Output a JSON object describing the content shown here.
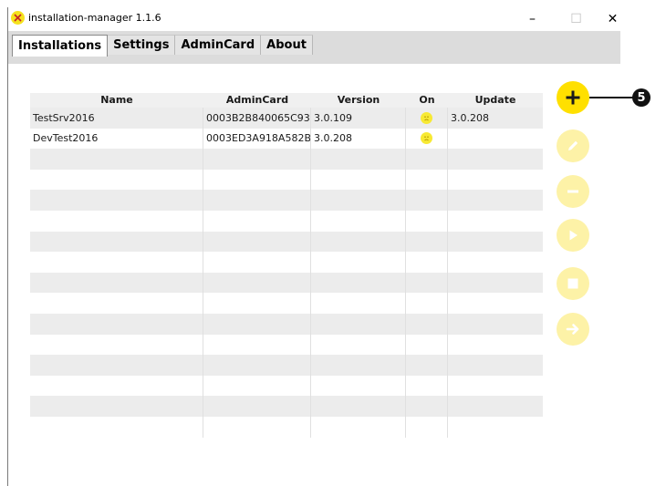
{
  "window": {
    "title": "installation-manager 1.1.6",
    "app_icon": "close-x-badge-icon",
    "minimize_glyph": "–",
    "maximize_glyph": "☐",
    "close_glyph": "✕"
  },
  "tabs": [
    {
      "label": "Installations",
      "active": true
    },
    {
      "label": "Settings",
      "active": false
    },
    {
      "label": "AdminCard",
      "active": false
    },
    {
      "label": "About",
      "active": false
    }
  ],
  "table": {
    "columns": [
      "Name",
      "AdminCard",
      "Version",
      "On",
      "Update"
    ],
    "rows": [
      {
        "name": "TestSrv2016",
        "admincard": "0003B2B840065C93",
        "version": "3.0.109",
        "on_icon": "sad-face-icon",
        "update": "3.0.208"
      },
      {
        "name": "DevTest2016",
        "admincard": "0003ED3A918A582B",
        "version": "3.0.208",
        "on_icon": "sad-face-icon",
        "update": ""
      }
    ],
    "empty_row_count": 14
  },
  "actions": [
    {
      "name": "add",
      "icon": "plus-icon",
      "enabled": true
    },
    {
      "name": "edit",
      "icon": "pencil-icon",
      "enabled": false
    },
    {
      "name": "remove",
      "icon": "minus-icon",
      "enabled": false
    },
    {
      "name": "start",
      "icon": "play-icon",
      "enabled": false
    },
    {
      "name": "stop",
      "icon": "stop-icon",
      "enabled": false
    },
    {
      "name": "forward",
      "icon": "arrow-right-icon",
      "enabled": false
    }
  ],
  "callout": {
    "label": "5"
  },
  "colors": {
    "accent": "#ffe000",
    "accent_disabled": "#fdf2a7",
    "icon_glyph_primary": "#1a1a1a",
    "icon_glyph_disabled": "#ffffff",
    "sad_face": "#f7e934"
  }
}
